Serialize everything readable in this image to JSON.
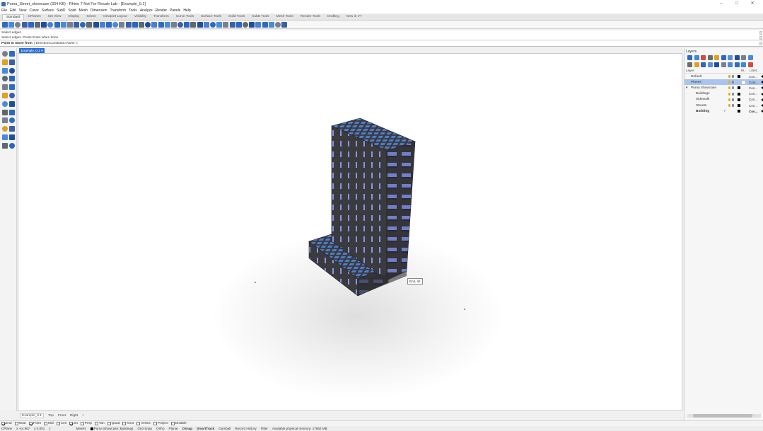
{
  "titlebar": {
    "title": "Puma_Street_showcase              (334 KB) - Rhino 7 Not For Resale Lab - [Example_0.1]",
    "minimize": "–",
    "maximize": "□",
    "close": "✕"
  },
  "menu": [
    "File",
    "Edit",
    "View",
    "Curve",
    "Surface",
    "SubD",
    "Solid",
    "Mesh",
    "Dimension",
    "Transform",
    "Tools",
    "Analyze",
    "Render",
    "Panels",
    "Help"
  ],
  "toolbar_tabs": [
    "Standard",
    "CPlanes",
    "Set View",
    "Display",
    "Select",
    "Viewport Layout",
    "Visibility",
    "Transform",
    "Curve Tools",
    "Surface Tools",
    "Solid Tools",
    "SubD Tools",
    "Mesh Tools",
    "Render Tools",
    "Drafting",
    "New in V7"
  ],
  "active_toolbar_tab": "Standard",
  "command": {
    "history": [
      "Select edges",
      "Select edges. Press Enter when done"
    ],
    "prompt_label": "Point to move from",
    "prompt_option": "( DirectionConstraint=None ):"
  },
  "viewport": {
    "tab_label": "Example_0.1",
    "tab_arrow": "▾",
    "snap_tooltip": "End, Int"
  },
  "view_tabs": [
    "Example_0.1",
    "Top",
    "Front",
    "Right",
    "+"
  ],
  "osnaps": [
    {
      "label": "End",
      "on": true
    },
    {
      "label": "Near",
      "on": false
    },
    {
      "label": "Point",
      "on": true
    },
    {
      "label": "Mid",
      "on": false
    },
    {
      "label": "Cen",
      "on": false
    },
    {
      "label": "Int",
      "on": true
    },
    {
      "label": "Perp",
      "on": false
    },
    {
      "label": "Tan",
      "on": false
    },
    {
      "label": "Quad",
      "on": false
    },
    {
      "label": "Knot",
      "on": false
    },
    {
      "label": "Vertex",
      "on": false
    },
    {
      "label": "Project",
      "on": false
    },
    {
      "label": "Disable",
      "on": false
    }
  ],
  "status": {
    "cplane": "CPlane",
    "x": "x -44.967",
    "y": "y 0.001",
    "z": "z",
    "units": "Meters",
    "layer": "Puma Showcase::Buildings",
    "grid_snap": "Grid Snap",
    "ortho": "Ortho",
    "planar": "Planar",
    "osnap": "Osnap",
    "smarttrack": "SmartTrack",
    "gumball": "Gumball",
    "record_history": "Record History",
    "filter": "Filter",
    "memory": "Available physical memory: 17962 MB"
  },
  "layers_panel": {
    "title": "Layers",
    "col_layer": "Layer",
    "col_m": "M...",
    "col_linetype": "Linet...",
    "rows": [
      {
        "name": "Default",
        "indent": 1,
        "selected": false,
        "bold": false,
        "check": "",
        "linetype": "Con..."
      },
      {
        "name": "Planes",
        "indent": 1,
        "selected": true,
        "bold": false,
        "check": "",
        "linetype": "Cont..."
      },
      {
        "name": "Puma Showcase",
        "indent": 0,
        "selected": false,
        "bold": false,
        "expand": "▾",
        "check": "",
        "linetype": "Con..."
      },
      {
        "name": "Buildings",
        "indent": 2,
        "selected": false,
        "bold": false,
        "check": "",
        "linetype": "Con..."
      },
      {
        "name": "Sidewalk",
        "indent": 2,
        "selected": false,
        "bold": false,
        "check": "",
        "linetype": "Con..."
      },
      {
        "name": "Streets",
        "indent": 2,
        "selected": false,
        "bold": false,
        "check": "",
        "linetype": "Con..."
      },
      {
        "name": "Building",
        "indent": 2,
        "selected": false,
        "bold": true,
        "check": "✓",
        "linetype": "Con..."
      }
    ]
  },
  "colors": {
    "accent": "#2d6fd6",
    "selected_row": "#a9c4ef",
    "building_dark": "#3a3a3d",
    "window_blue": "#6d80c9"
  }
}
